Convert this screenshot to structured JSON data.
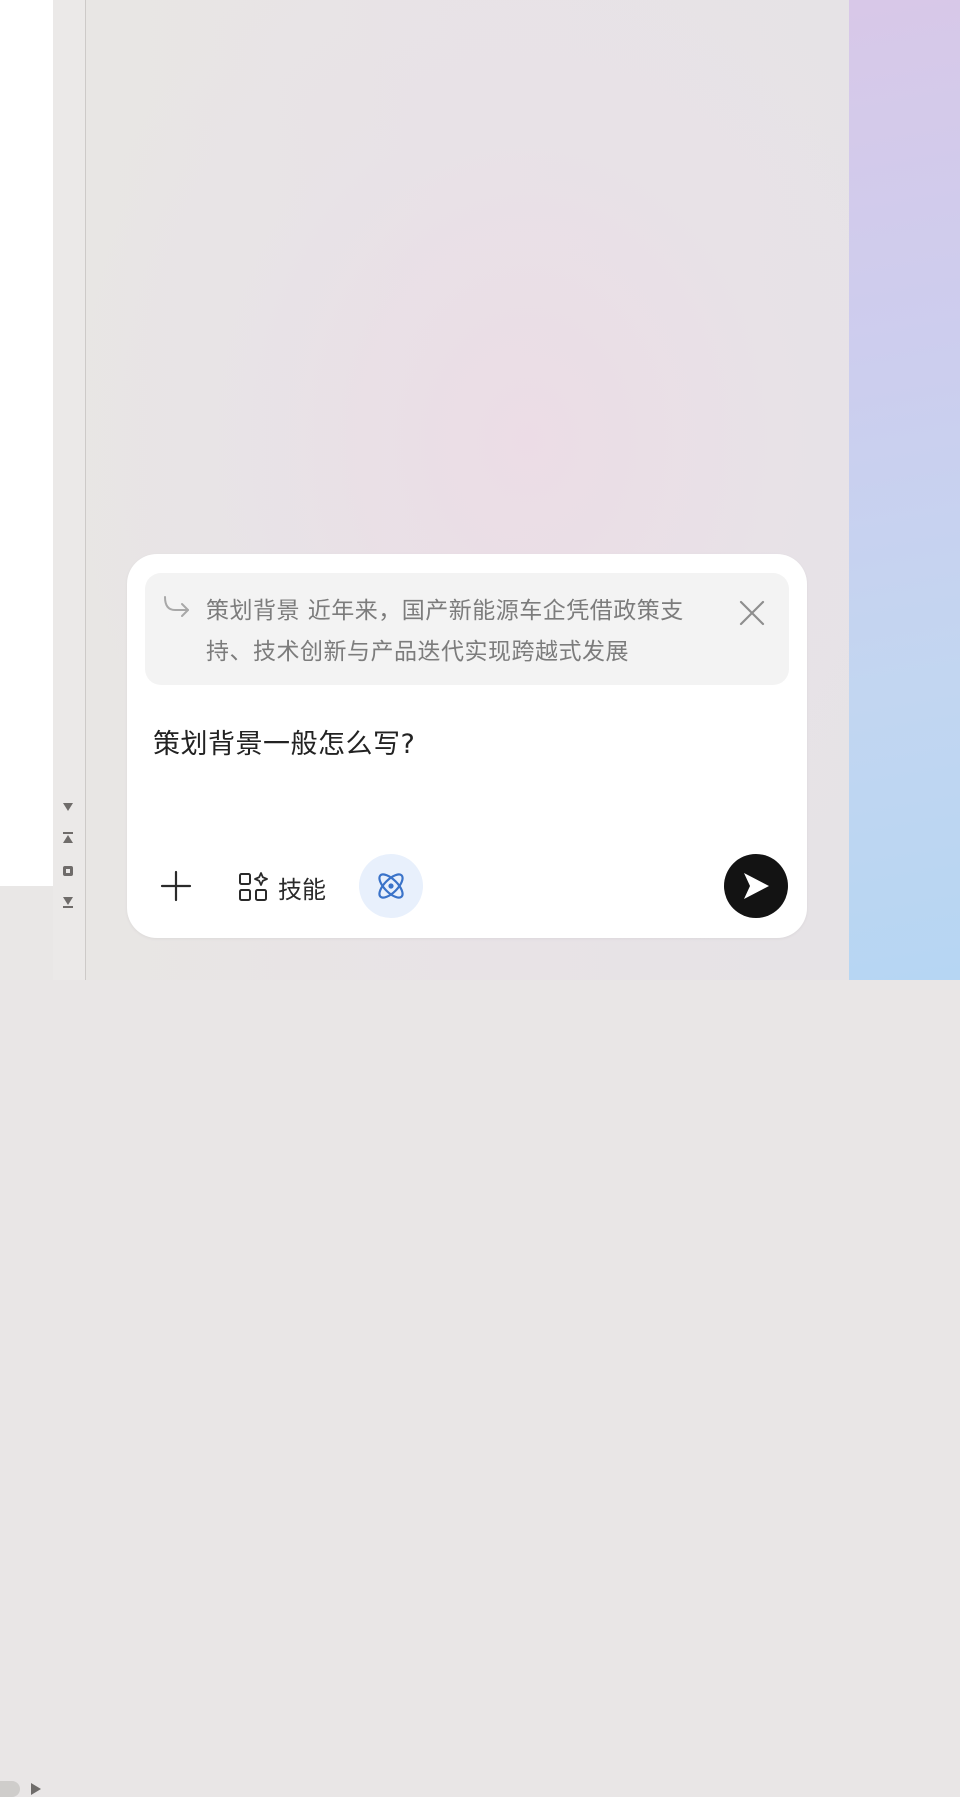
{
  "quote": {
    "text": "策划背景 近年来，国产新能源车企凭借政策支持、技术创新与产品迭代实现跨越式发展",
    "icons": [
      "reply-arrow-icon",
      "close-icon"
    ]
  },
  "input": {
    "value": "策划背景一般怎么写?"
  },
  "toolbar": {
    "plus_icon": "plus-icon",
    "skills_label": "技能",
    "skills_icon": "apps-sparkle-icon",
    "atom_icon": "atom-icon",
    "send_icon": "send-icon"
  },
  "colors": {
    "send_button": "#131313",
    "atom_button_bg": "#e8f0fc",
    "atom_icon": "#3a73c9",
    "quote_bg": "#f3f3f3"
  }
}
